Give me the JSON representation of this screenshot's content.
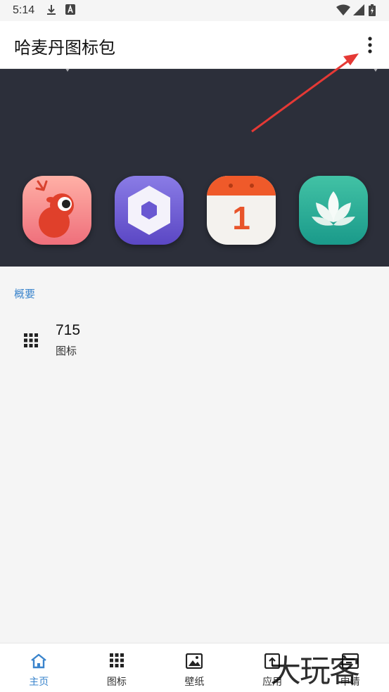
{
  "status_bar": {
    "time": "5:14"
  },
  "app_bar": {
    "title": "哈麦丹图标包"
  },
  "overview": {
    "section_label": "概要",
    "icon_count": "715",
    "icon_count_caption": "图标"
  },
  "bottom_nav": [
    {
      "label": "主页",
      "icon": "home-icon",
      "active": true
    },
    {
      "label": "图标",
      "icon": "grid-icon",
      "active": false
    },
    {
      "label": "壁纸",
      "icon": "image-icon",
      "active": false
    },
    {
      "label": "应用",
      "icon": "apply-icon",
      "active": false
    },
    {
      "label": "申请",
      "icon": "request-icon",
      "active": false
    }
  ],
  "hero_icons": [
    {
      "name": "deer-app-icon"
    },
    {
      "name": "hexagon-app-icon"
    },
    {
      "name": "calendar-app-icon",
      "label": "1"
    },
    {
      "name": "lotus-app-icon"
    }
  ],
  "watermark": "大玩客",
  "colors": {
    "accent": "#3a84cc",
    "hero_bg": "#2c2f3a",
    "arrow": "#e53935"
  }
}
